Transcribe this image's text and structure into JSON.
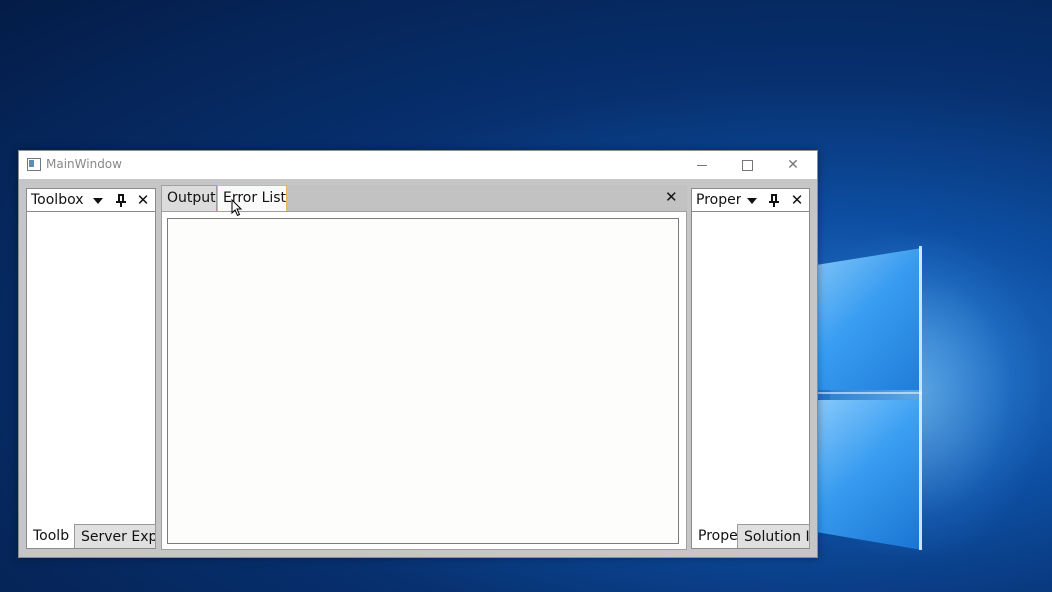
{
  "desktop": {
    "accent": "#0d4fa3"
  },
  "window": {
    "title": "MainWindow",
    "controls": {
      "minimize": "minimize-icon",
      "maximize": "maximize-icon",
      "close": "✕"
    }
  },
  "left_pane": {
    "title": "Toolbox",
    "header_icons": [
      "dropdown-icon",
      "pin-icon",
      "close-icon"
    ],
    "close_glyph": "✕",
    "tabs": [
      {
        "label": "Toolb",
        "active": true
      },
      {
        "label": "Server Expl",
        "active": false
      }
    ]
  },
  "document_area": {
    "tabs": [
      {
        "label": "Output",
        "active": false
      },
      {
        "label": "Error List",
        "active": true
      }
    ],
    "close_glyph": "✕",
    "active_tab_border": "#e3b85c"
  },
  "right_pane": {
    "title": "Proper",
    "header_icons": [
      "dropdown-icon",
      "pin-icon",
      "close-icon"
    ],
    "close_glyph": "✕",
    "tabs": [
      {
        "label": "Prope",
        "active": true
      },
      {
        "label": "Solution I",
        "active": false
      }
    ]
  }
}
